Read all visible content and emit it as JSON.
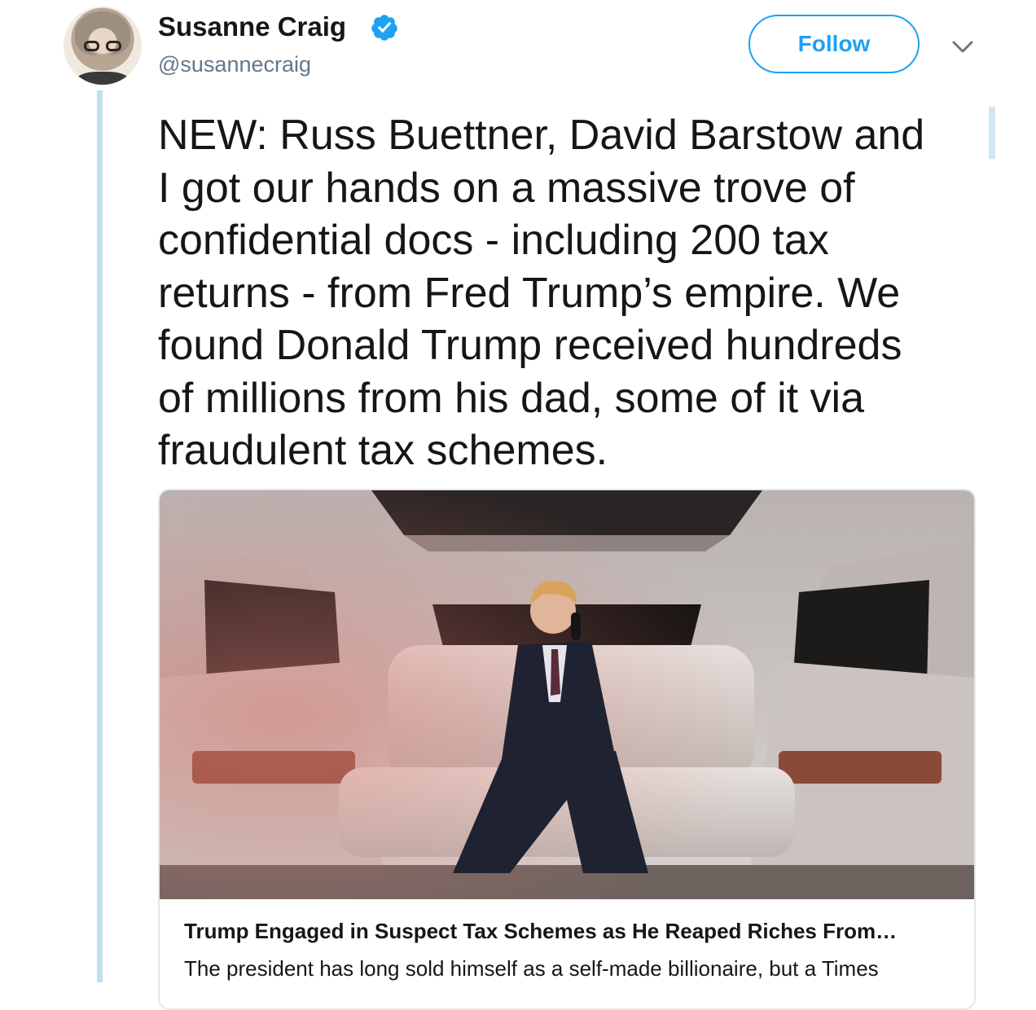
{
  "author": {
    "name": "Susanne Craig",
    "handle": "@susannecraig",
    "verified": true
  },
  "header": {
    "follow_label": "Follow",
    "menu_icon": "chevron-down-icon"
  },
  "tweet": {
    "text_lines": [
      "NEW: Russ Buettner, David Barstow and",
      "I got our hands on a massive trove of",
      "confidential docs - including 200 tax",
      "returns - from Fred Trump’s empire. We",
      "found Donald Trump received hundreds",
      "of millions from his dad, some of it via",
      "fraudulent tax schemes."
    ]
  },
  "card": {
    "title": "Trump Engaged in Suspect Tax Schemes as He Reaped Riches From…",
    "description": "The president has long sold himself as a self-made billionaire, but a Times"
  },
  "colors": {
    "accent": "#1da1f2",
    "text": "#14171a",
    "muted": "#657786",
    "thread_line": "#c4e0ee",
    "card_border": "#e1e8ed"
  }
}
